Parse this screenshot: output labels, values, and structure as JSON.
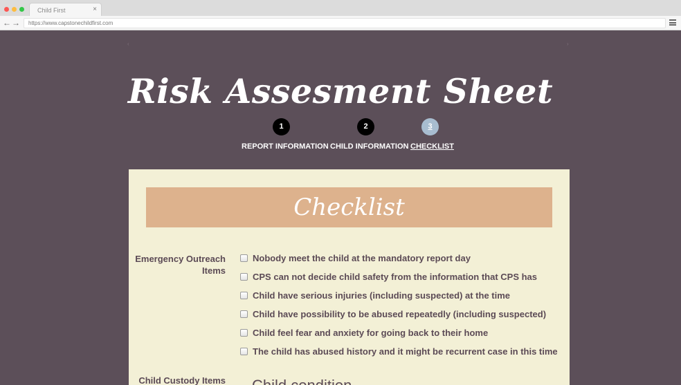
{
  "browser": {
    "tab_title": "Child First",
    "tab_close": "×",
    "url": "https://www.capstonechildfirst.com",
    "back_icon": "arrow-left-icon",
    "forward_icon": "arrow-right-icon",
    "menu_icon": "hamburger-menu-icon"
  },
  "page": {
    "title": "Risk Assesment Sheet",
    "colors": {
      "background": "#5c4f59",
      "card": "#f3f0d6",
      "card_header": "#ddb28d",
      "step_active": "#a8bdd0",
      "text": "#5b4a55"
    },
    "steps": [
      {
        "number": "1",
        "label": "REPORT INFORMATION",
        "active": false
      },
      {
        "number": "2",
        "label": "CHILD INFORMATION",
        "active": false
      },
      {
        "number": "3",
        "label": "CHECKLIST",
        "active": true
      }
    ]
  },
  "checklist": {
    "heading": "Checklist",
    "emergency": {
      "label": "Emergency Outreach Items",
      "items": [
        "Nobody meet the child at the mandatory report day",
        "CPS can not decide child safety from the information that CPS has",
        "Child have serious injuries (including suspected) at the time",
        "Child have possibility to be abused repeatedly (including suspected)",
        "Child feel fear and anxiety for going back to their home",
        "The child has abused history and it might be recurrent case in this time"
      ]
    },
    "custody": {
      "label": "Child Custody Items",
      "subheading": "Child condition"
    }
  }
}
